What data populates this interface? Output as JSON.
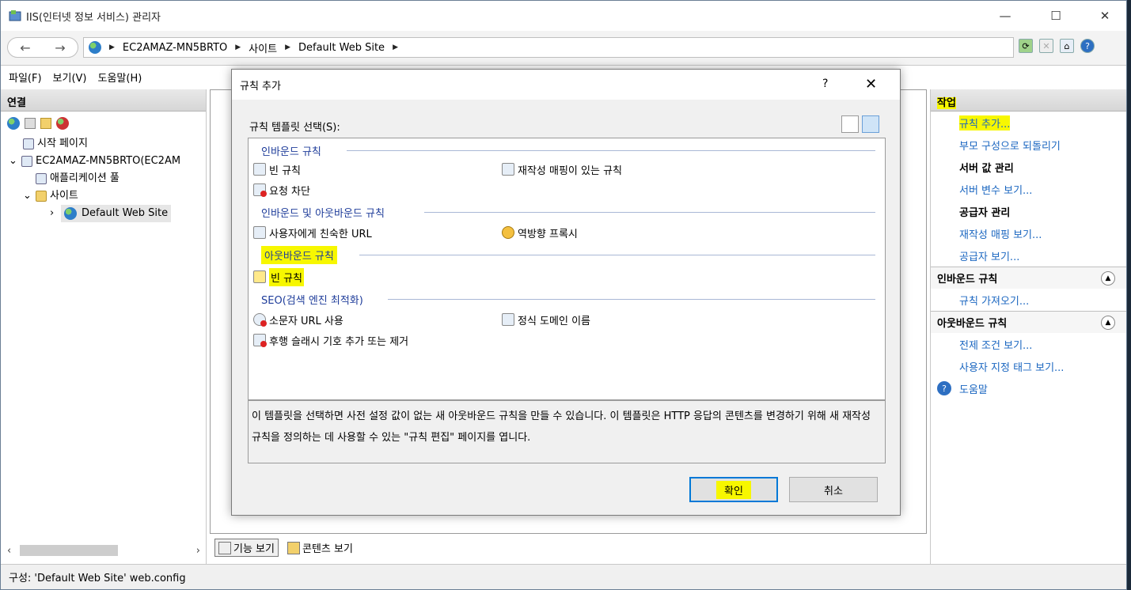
{
  "window": {
    "title": "IIS(인터넷 정보 서비스) 관리자",
    "controls": {
      "minimize": "—",
      "maximize": "☐",
      "close": "✕"
    }
  },
  "address": {
    "back": "←",
    "forward": "→",
    "crumbs": [
      "EC2AMAZ-MN5BRTO",
      "사이트",
      "Default Web Site"
    ]
  },
  "menu": [
    "파일(F)",
    "보기(V)",
    "도움말(H)"
  ],
  "connections": {
    "title": "연결",
    "tree": [
      {
        "label": "시작 페이지"
      },
      {
        "label": "EC2AMAZ-MN5BRTO(EC2AM"
      },
      {
        "label": "애플리케이션 풀"
      },
      {
        "label": "사이트"
      },
      {
        "label": "Default Web Site"
      }
    ]
  },
  "center": {
    "views": [
      "기능 보기",
      "콘텐츠 보기"
    ]
  },
  "status": "구성: 'Default Web Site' web.config",
  "actions": {
    "title": "작업",
    "add_rule": "규칙 추가...",
    "revert": "부모 구성으로 되돌리기",
    "server_vars_head": "서버 값 관리",
    "server_vars": "서버 변수 보기...",
    "providers_head": "공급자 관리",
    "rewrite_maps": "재작성 매핑 보기...",
    "providers": "공급자 보기...",
    "inbound_sect": "인바운드 규칙",
    "import_rules": "규칙 가져오기...",
    "outbound_sect": "아웃바운드 규칙",
    "preconditions": "전제 조건 보기...",
    "custom_tags": "사용자 지정 태그 보기...",
    "help": "도움말"
  },
  "dialog": {
    "title": "규칙 추가",
    "help": "?",
    "close": "✕",
    "template_label": "규칙 템플릿 선택(S):",
    "groups": {
      "inbound": "인바운드 규칙",
      "in_out": "인바운드 및 아웃바운드 규칙",
      "outbound": "아웃바운드 규칙",
      "seo": "SEO(검색 엔진 최적화)"
    },
    "items": {
      "blank_rule": "빈 규칙",
      "rewrite_map_rule": "재작성 매핑이 있는 규칙",
      "request_block": "요청 차단",
      "friendly_url": "사용자에게 친숙한 URL",
      "reverse_proxy": "역방향 프록시",
      "outbound_blank": "빈 규칙",
      "lowercase_url": "소문자 URL 사용",
      "canonical_domain": "정식 도메인 이름",
      "trailing_slash": "후행 슬래시 기호 추가 또는 제거"
    },
    "description": "이 템플릿을 선택하면 사전 설정 값이 없는 새 아웃바운드 규칙을 만들 수 있습니다. 이 템플릿은 HTTP 응답의 콘텐츠를 변경하기 위해 새 재작성 규칙을 정의하는 데 사용할 수 있는 \"규칙 편집\" 페이지를 엽니다.",
    "ok": "확인",
    "cancel": "취소"
  },
  "colors": {
    "highlight": "#f7f700",
    "link": "#1a66c0",
    "group_text": "#1e3c9a"
  }
}
